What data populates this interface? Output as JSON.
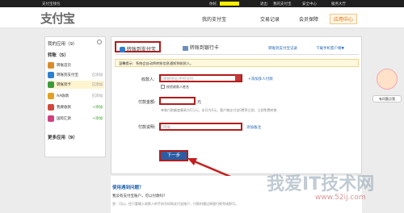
{
  "topbar": {
    "app_name": "支付宝钱包",
    "greeting": "你好,",
    "items": [
      "退出",
      "我的支付宝",
      "安全中心",
      "服务大厅"
    ]
  },
  "header": {
    "logo": "支付宝",
    "nav": [
      "我的支付宝",
      "交易记录",
      "会员保障",
      "应用中心"
    ]
  },
  "sidebar": {
    "my_apps": "我的应用（9）",
    "transfer": "转账（5）",
    "items": [
      {
        "label": "转账首页",
        "tag": ""
      },
      {
        "label": "转账到支付宝",
        "tag": "已添加"
      },
      {
        "label": "转账到卡",
        "tag": "已添加"
      },
      {
        "label": "AA收款",
        "tag": "已添加"
      },
      {
        "label": "我要收款",
        "tag": "+添加"
      },
      {
        "label": "国际汇款",
        "tag": "+添加"
      }
    ],
    "more": "更多应用（9）"
  },
  "main": {
    "tab_alipay": "转账到支付宝",
    "tab_bank": "转账到银行卡",
    "link_records": "转账到支付宝记录",
    "link_mobile": "下载手机客户端▼",
    "notice": "温馨提示：系统会自动将转账信息通知到收款人。",
    "recipient_label": "收款人:",
    "recipient_placeholder": "邮箱地址/手机号码",
    "add_multiple": "+添加多人付款",
    "verify_name": "校验收款人姓名",
    "amount_label": "付款金额:",
    "amount_unit": "元",
    "amount_hint": "单笔付款额度最高为5万元，本月为0元。客户端支付宝0费率立即，立即免费转账",
    "note_label": "付款说明:",
    "note_placeholder": "转账",
    "note_extra": "添加备注",
    "next_button": "下一步"
  },
  "faq": {
    "title": "使用遇到问题？",
    "q1": "我没有支付宝账户，可以付款吗？",
    "a1": "答：可以。往只要输入收款人的手机号码和支付宝账户，付款时通过网银付款完成即可。"
  },
  "widget": {
    "label": "有问题点我"
  },
  "watermark": {
    "text": "我爱IT技术网",
    "url": "www.52ij.com"
  }
}
